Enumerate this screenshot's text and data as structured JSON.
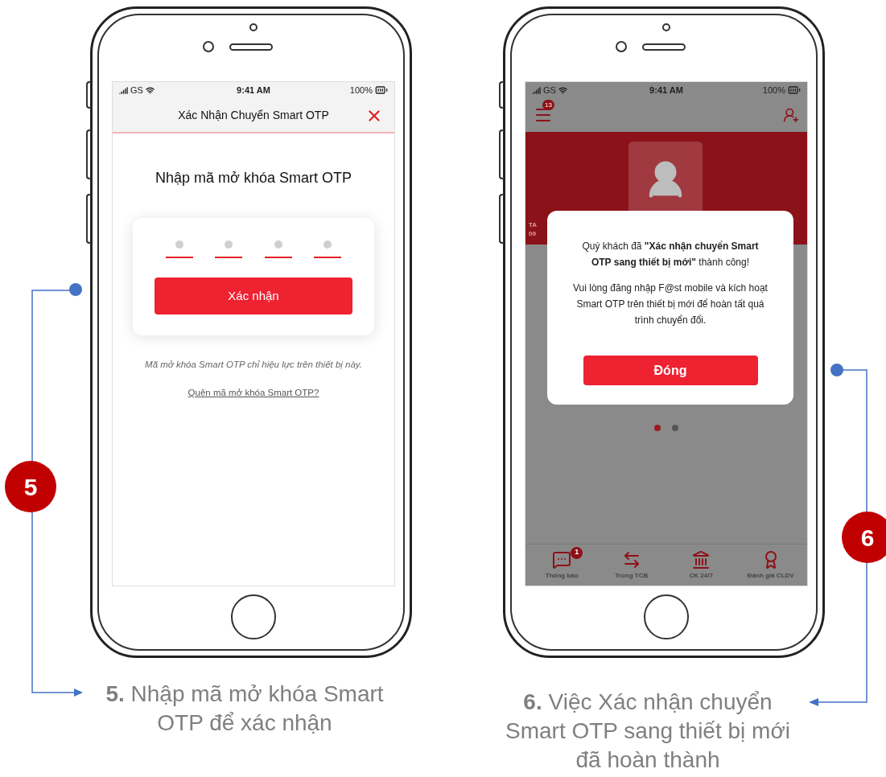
{
  "phones": [
    {
      "kind": "otp_entry",
      "step": "5",
      "caption": "**5.** Nhập mã mở khóa Smart OTP để xác nhận",
      "status_bar": {
        "carrier": "GS",
        "time": "9:41 AM",
        "battery": "100%"
      },
      "header": {
        "title": "Xác Nhận Chuyển Smart OTP"
      },
      "heading": "Nhập mã mở khóa Smart OTP",
      "pin_slots": [
        {
          "filled": false
        },
        {
          "filled": false
        },
        {
          "filled": false
        },
        {
          "filled": false
        }
      ],
      "button": "Xác nhận",
      "note": "Mã mở khóa Smart OTP chỉ hiệu lực trên thiết bị này.",
      "link": "Quên mã mở khóa Smart OTP?"
    },
    {
      "kind": "success_dialog",
      "step": "6",
      "caption": "**6.** Việc Xác nhận chuyển Smart OTP sang thiết bị mới đã hoàn thành",
      "status_bar": {
        "carrier": "GS",
        "time": "9:41 AM",
        "battery": "100%"
      },
      "menu_badge": "13",
      "card_fragments": [
        "TA",
        "09"
      ],
      "dialog": {
        "message": "Quý khách đã **\"Xác nhận chuyển Smart OTP sang thiết bị mới\"** thành công!",
        "instruction": "Vui lòng đăng nhập F@st mobile và kích hoạt Smart OTP trên thiết bị mới để hoàn tất quá trình chuyển đổi.",
        "button": "Đóng"
      },
      "page_dots": [
        {
          "selected": true
        },
        {
          "selected": false
        }
      ],
      "tab_bar": [
        {
          "label": "Thông báo",
          "badge": "1"
        },
        {
          "label": "Trong TCB"
        },
        {
          "label": "CK 24/7"
        },
        {
          "label": "Đánh giá CLDV"
        }
      ]
    }
  ]
}
